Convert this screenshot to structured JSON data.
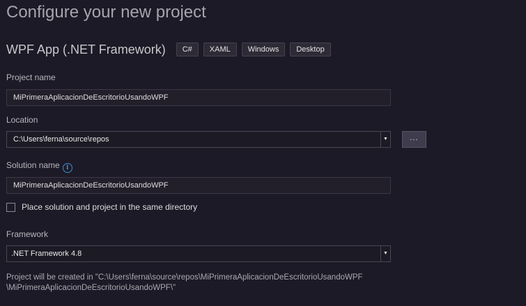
{
  "header": {
    "title": "Configure your new project",
    "template_name": "WPF App (.NET Framework)",
    "tags": [
      "C#",
      "XAML",
      "Windows",
      "Desktop"
    ]
  },
  "form": {
    "project_name": {
      "label": "Project name",
      "value": "MiPrimeraAplicacionDeEscritorioUsandoWPF"
    },
    "location": {
      "label": "Location",
      "value": "C:\\Users\\ferna\\source\\repos",
      "browse_label": "..."
    },
    "solution_name": {
      "label": "Solution name",
      "value": "MiPrimeraAplicacionDeEscritorioUsandoWPF"
    },
    "same_directory": {
      "label": "Place solution and project in the same directory",
      "checked": false
    },
    "framework": {
      "label": "Framework",
      "value": ".NET Framework 4.8"
    }
  },
  "summary": {
    "line1": "Project will be created in \"C:\\Users\\ferna\\source\\repos\\MiPrimeraAplicacionDeEscritorioUsandoWPF",
    "line2": "\\MiPrimeraAplicacionDeEscritorioUsandoWPF\\\""
  },
  "icons": {
    "info": "info-icon",
    "dropdown": "chevron-down-icon"
  },
  "colors": {
    "background": "#1d1a27",
    "accent": "#3e8ed0"
  }
}
